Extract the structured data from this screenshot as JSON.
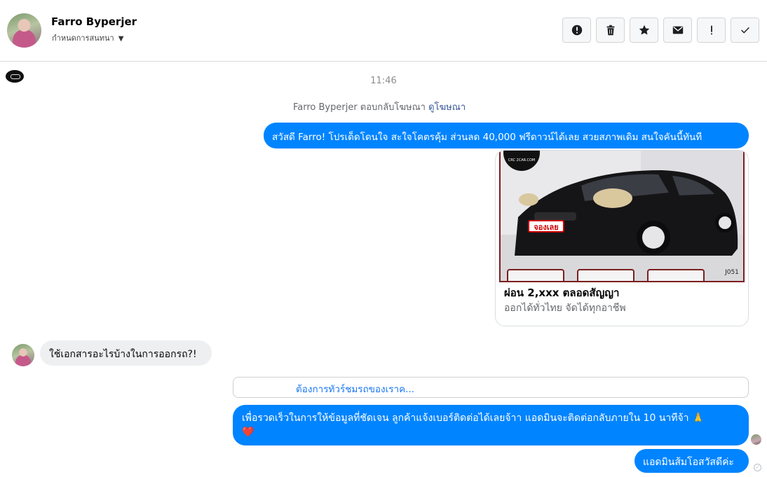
{
  "header": {
    "contact_name": "Farro Byperjer",
    "assign_label": "กำหนดการสนทนา",
    "actions": [
      "spam-report",
      "delete",
      "star",
      "mark-unread",
      "follow-up",
      "done"
    ]
  },
  "conversation": {
    "timestamp": "11:46",
    "reply_note": {
      "text": "Farro Byperjer ตอบกลับโฆษณา",
      "link": "ดูโฆษณา"
    },
    "messages": [
      {
        "id": "m1",
        "direction": "outgoing",
        "text": "สวัสดี Farro! โปรเด็ดโดนใจ สะใจโคตรคุ้ม ส่วนลด 40,000 ฟรีดาวน์ได้เลย สวยสภาพเดิม สนใจคันนี้ทันที"
      },
      {
        "id": "m2",
        "direction": "outgoing",
        "type": "ad-card",
        "image_badge": "จองเลย",
        "image_logo": "CRC 2CAR.COM",
        "image_code": "J051",
        "title": "ผ่อน 2,xxx ตลอดสัญญา",
        "description": "ออกได้ทั่วไทย จัดได้ทุกอาชีพ"
      },
      {
        "id": "m3",
        "direction": "incoming",
        "text": "ใช้เอกสารอะไรบ้างในการออกรถ?!"
      },
      {
        "id": "m4",
        "direction": "outgoing",
        "type": "suggestion",
        "text": "ต้องการทัวร์ชมรถของเราค..."
      },
      {
        "id": "m5",
        "direction": "outgoing",
        "line1": "เพื่อรวดเร็วในการให้ข้อมูลที่ชัดเจน ลูกค้าแจ้งเบอร์ติดต่อได้เลยจ้าา แอดมินจะติดต่อกลับภายใน 10 นาทีจ้า 🙏",
        "line2": "❤️"
      },
      {
        "id": "m6",
        "direction": "outgoing",
        "text": "แอดมินส้มโอสวัสดีค่ะ"
      }
    ]
  },
  "colors": {
    "outgoing_bubble": "#0084ff",
    "incoming_bubble": "#eeeff1",
    "link": "#385898"
  }
}
